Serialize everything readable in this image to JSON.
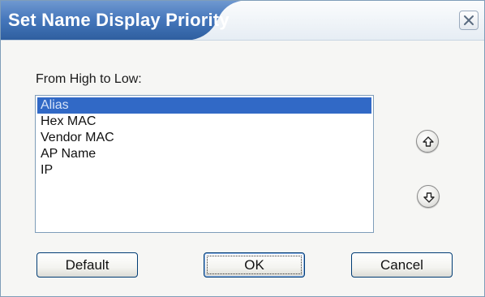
{
  "window": {
    "title": "Set Name Display Priority",
    "close_icon": "close-icon"
  },
  "main": {
    "list_label": "From High to Low:",
    "priority_list": [
      {
        "label": "Alias",
        "selected": true
      },
      {
        "label": "Hex MAC",
        "selected": false
      },
      {
        "label": "Vendor MAC",
        "selected": false
      },
      {
        "label": "AP Name",
        "selected": false
      },
      {
        "label": "IP",
        "selected": false
      }
    ],
    "move_up_icon": "arrow-up-icon",
    "move_down_icon": "arrow-down-icon"
  },
  "buttons": {
    "default_label": "Default",
    "ok_label": "OK",
    "cancel_label": "Cancel"
  },
  "colors": {
    "title_tab": "#3d6eb3",
    "selection": "#3169c6",
    "border": "#7f9db9"
  }
}
